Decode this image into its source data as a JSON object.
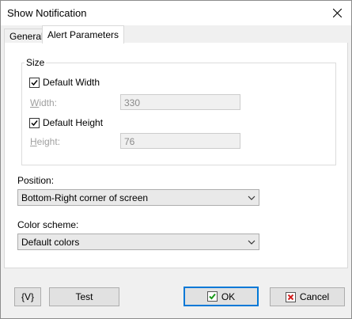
{
  "window": {
    "title": "Show Notification"
  },
  "tabs": [
    {
      "label": "General"
    },
    {
      "label": "Alert Parameters"
    }
  ],
  "size_group": {
    "legend": "Size",
    "default_width": {
      "label": "Default Width",
      "checked": true
    },
    "width": {
      "label": "Width:",
      "value": "330"
    },
    "default_height": {
      "label": "Default Height",
      "checked": true
    },
    "height": {
      "label": "Height:",
      "value": "76"
    }
  },
  "position": {
    "label": "Position:",
    "selected": "Bottom-Right corner of screen"
  },
  "color_scheme": {
    "label": "Color scheme:",
    "selected": "Default colors"
  },
  "buttons": {
    "variables": "{V}",
    "test": "Test",
    "ok": "OK",
    "cancel": "Cancel"
  },
  "colors": {
    "ok_icon": "#1a9a1a",
    "cancel_icon": "#d21f1f",
    "focus": "#0078d7"
  }
}
